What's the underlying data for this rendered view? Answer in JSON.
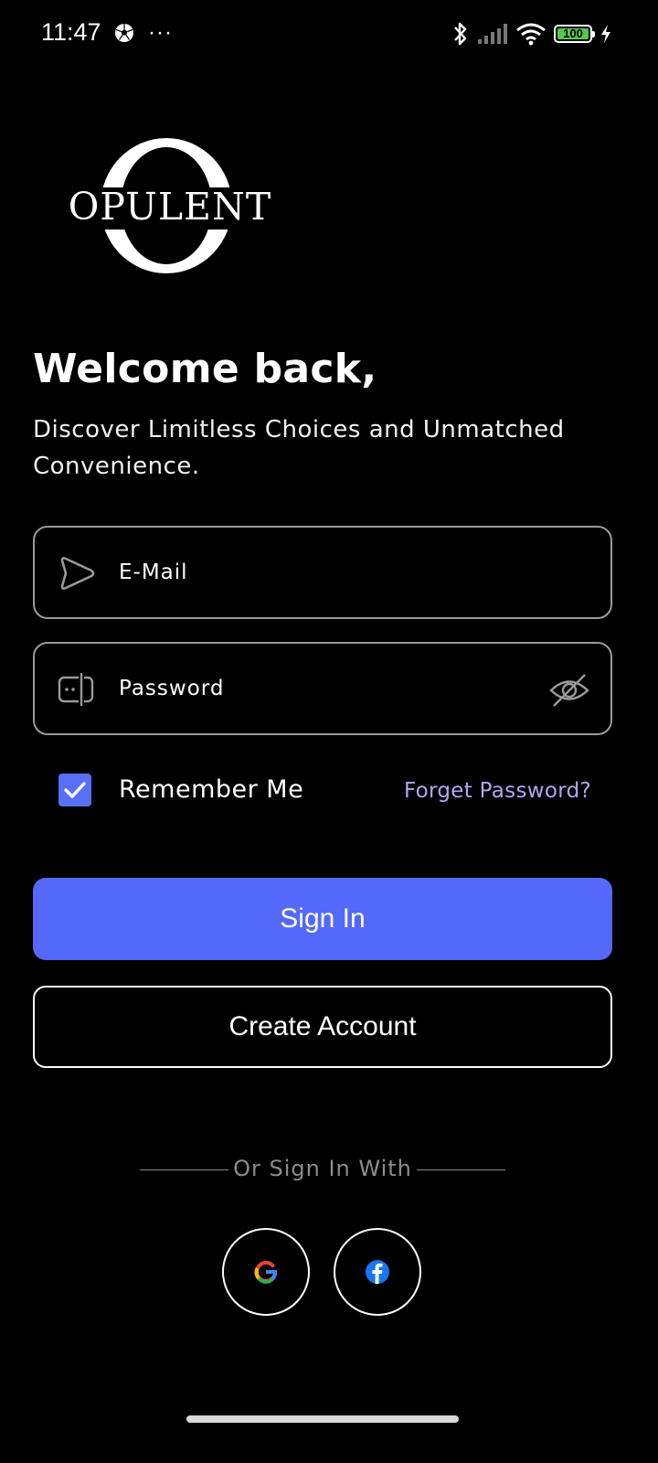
{
  "status_bar": {
    "time": "11:47",
    "overflow": "···",
    "battery": "100",
    "icons": [
      "soccer-ball-icon",
      "bluetooth-icon",
      "signal-icon",
      "wifi-icon",
      "battery-icon",
      "charging-icon"
    ]
  },
  "brand": {
    "logo_text": "OPULENT"
  },
  "header": {
    "title": "Welcome back,",
    "subtitle": "Discover Limitless Choices and Unmatched Convenience."
  },
  "form": {
    "email": {
      "placeholder": "E-Mail",
      "value": "",
      "icon": "send-icon"
    },
    "password": {
      "placeholder": "Password",
      "value": "",
      "icon": "password-icon",
      "toggle_icon": "eye-slash-icon"
    },
    "remember_me": {
      "label": "Remember Me",
      "checked": true
    },
    "forgot_password": "Forget Password?"
  },
  "actions": {
    "sign_in": "Sign In",
    "create_account": "Create Account"
  },
  "social": {
    "divider": "Or Sign In With",
    "providers": [
      "google-icon",
      "facebook-icon"
    ]
  },
  "colors": {
    "background": "#000000",
    "primary": "#5469F9",
    "link": "#B3A6F0",
    "border": "#9A9A9A"
  }
}
